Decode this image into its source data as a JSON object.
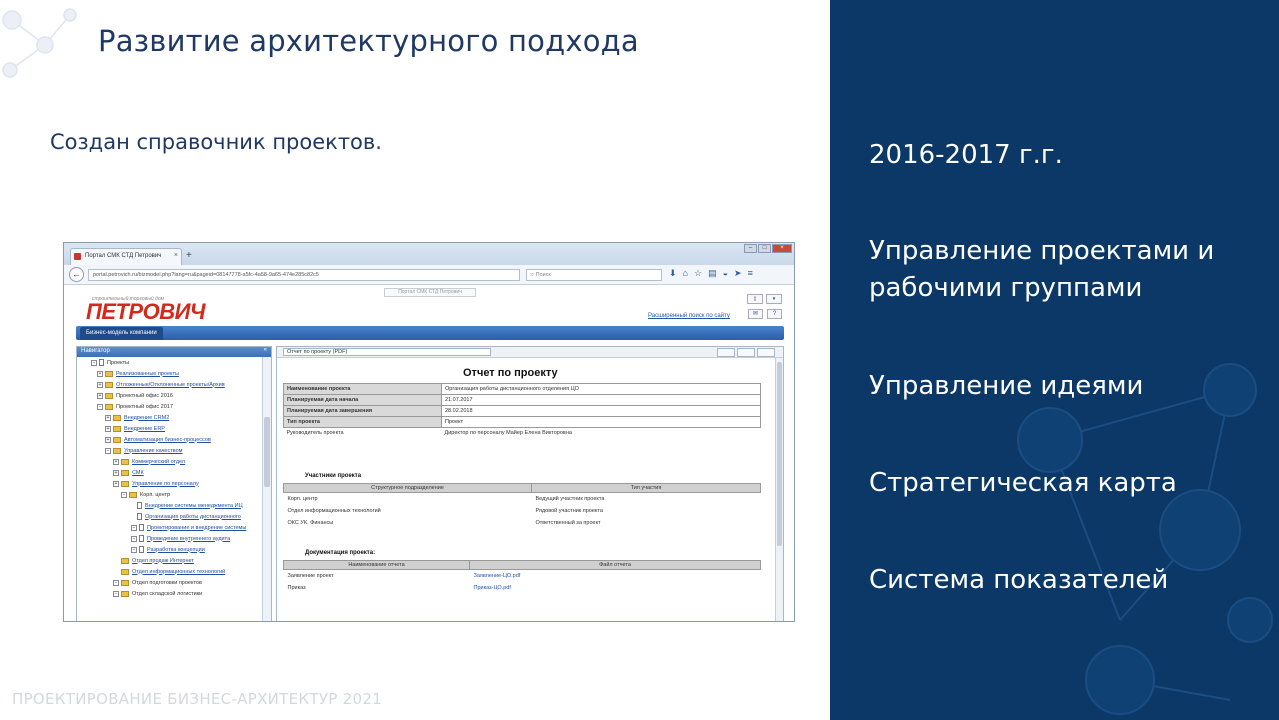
{
  "slide": {
    "title": "Развитие архитектурного подхода",
    "subtitle": "Создан справочник проектов.",
    "footer": "ПРОЕКТИРОВАНИЕ БИЗНЕС-АРХИТЕКТУР 2021"
  },
  "right_panel": {
    "items": [
      "2016-2017 г.г.",
      "Управление проектами и рабочими группами",
      "Управление идеями",
      "Стратегическая карта",
      "Система показателей"
    ],
    "bg_color": "#0b3866"
  },
  "browser": {
    "tab_title": "Портал СМК СТД Петрович",
    "url": "portal.petrovich.ru/bizmodel.php?lang=ru&pageid=08147778-a5fc-4a58-9a65-474e285c82c5",
    "search_placeholder": "Поиск",
    "hint": "Портал СМК СТД Петрович"
  },
  "portal": {
    "logo_caption": "строительный торговый дом",
    "logo": "ПЕТРОВИЧ",
    "advanced_search": "Расширенный поиск по сайту",
    "nav_tab": "Бизнес-модель компании",
    "nav_title": "Навигатор",
    "tree": [
      "Проекты",
      "Реализованные проекты",
      "Отложенные/Отклоненные проекты/Архив",
      "Проектный офис 2016",
      "Проектный офис 2017",
      "Внедрение CRM2",
      "Внедрение ERP",
      "Автоматизация бизнес-процессов",
      "Управление качеством",
      "Коммерческий отдел",
      "СМК",
      "Управление по персоналу",
      "Корп. центр",
      "Внедрение системы менеджмента ИЦ",
      "Организация работы дистанционного",
      "Проектирование и внедрение системы",
      "Проведение внутреннего аудита",
      "Разработка концепции",
      "Отдел продаж Интернет",
      "Отдел информационных технологий",
      "Отдел подготовки проектов",
      "Отдел складской логистики"
    ],
    "report_select": "Отчет по проекту (PDF)",
    "report_title": "Отчет по проекту",
    "info": [
      {
        "k": "Наименование проекта",
        "v": "Организация работы дистанционного отделения ЦО"
      },
      {
        "k": "Планируемая дата начала",
        "v": "21.07.2017"
      },
      {
        "k": "Планируемая дата завершения",
        "v": "28.02.2018"
      },
      {
        "k": "Тип проекта",
        "v": "Проект"
      },
      {
        "k": "Руководитель проекта",
        "v": "Директор по персоналу Майер Елена Викторовна"
      }
    ],
    "participants_title": "Участники проекта",
    "participants_headers": [
      "Структурное подразделение",
      "Тип участия"
    ],
    "participants": [
      {
        "unit": "Корп. центр",
        "role": "Ведущий участник проекта"
      },
      {
        "unit": "Отдел информационных технологий",
        "role": "Рядовой участник проекта"
      },
      {
        "unit": "ОКС УК. Финансы",
        "role": "Ответственный за проект"
      }
    ],
    "docs_title": "Документация проекта:",
    "docs_headers": [
      "Наименование отчета",
      "Файл отчета"
    ],
    "docs": [
      {
        "name": "Заявление проект",
        "file": "Заявление-ЦО.pdf"
      },
      {
        "name": "Приказ",
        "file": "Приказ-ЦО.pdf"
      }
    ]
  }
}
